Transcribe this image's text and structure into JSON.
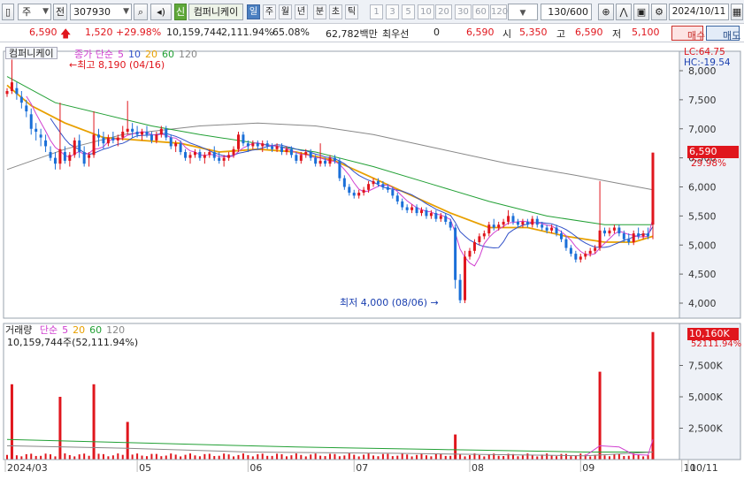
{
  "toolbar": {
    "market": "주",
    "prefix": "전",
    "code": "307930",
    "new_tag": "신",
    "stock_name": "컴퍼니케이",
    "periods": [
      "일",
      "주",
      "월",
      "년",
      "분",
      "초",
      "틱"
    ],
    "active_period": "일",
    "intervals": [
      "1",
      "3",
      "5",
      "10",
      "20",
      "30",
      "60",
      "120"
    ],
    "count": "130",
    "total": "/600",
    "date": "2024/10/11"
  },
  "quote": {
    "price": "6,590",
    "change": "1,520",
    "change_pct": "+29.98%",
    "volume": "10,159,744",
    "volume_ratio": "2,111.94%",
    "turnover": "65.08%",
    "amount": "62,782백만",
    "priority_label": "최우선",
    "priority_value": "0",
    "current": "6,590",
    "open_label": "시",
    "open": "5,350",
    "high_label": "고",
    "high": "6,590",
    "low_label": "저",
    "low": "5,100",
    "buy_label": "매수",
    "sell_label": "매도"
  },
  "price_panel": {
    "stock_tag": "컴퍼니케이",
    "legend": [
      {
        "text": "종가 단순",
        "color": "#d040d0"
      },
      {
        "text": "5",
        "color": "#d040d0"
      },
      {
        "text": "10",
        "color": "#3050c8"
      },
      {
        "text": "20",
        "color": "#e8a000"
      },
      {
        "text": "60",
        "color": "#22a035"
      },
      {
        "text": "120",
        "color": "#888888"
      }
    ],
    "high_annotation": "최고 8,190 (04/16)",
    "low_annotation": "최저 4,000 (08/06)",
    "lc": "LC:64.75",
    "hc": "HC:-19.54",
    "current_badge": "6,590",
    "current_pct": "29.98%",
    "y_ticks": [
      "8,000",
      "7,500",
      "7,000",
      "6,500",
      "6,000",
      "5,500",
      "5,000",
      "4,500",
      "4,000"
    ],
    "y_tick_values": [
      8000,
      7500,
      7000,
      6500,
      6000,
      5500,
      5000,
      4500,
      4000
    ]
  },
  "volume_panel": {
    "title": "거래량",
    "legend": [
      {
        "text": "단순",
        "color": "#d040d0"
      },
      {
        "text": "5",
        "color": "#d040d0"
      },
      {
        "text": "20",
        "color": "#e8a000"
      },
      {
        "text": "60",
        "color": "#22a035"
      },
      {
        "text": "120",
        "color": "#888888"
      }
    ],
    "summary": "10,159,744주(52,111.94%)",
    "current_badge": "10,160K",
    "current_pct": "52111.94%",
    "y_ticks": [
      "7,500K",
      "5,000K",
      "2,500K"
    ],
    "y_tick_values": [
      7500,
      5000,
      2500
    ]
  },
  "x_axis": {
    "labels": [
      {
        "text": "2024/03",
        "day": 0
      },
      {
        "text": "05",
        "day": 27
      },
      {
        "text": "06",
        "day": 50
      },
      {
        "text": "07",
        "day": 72
      },
      {
        "text": "08",
        "day": 96
      },
      {
        "text": "09",
        "day": 119
      },
      {
        "text": "10",
        "day": 140
      },
      {
        "text": "10/11",
        "day": 157
      }
    ]
  },
  "colors": {
    "up": "#e0161d",
    "down": "#1a6fd8",
    "ma5": "#d040d0",
    "ma10": "#3050c8",
    "ma20": "#e8a000",
    "ma60": "#22a035",
    "ma120": "#888888"
  },
  "chart_data": {
    "type": "candlestick",
    "x_unit": "trading day",
    "ylim": [
      3800,
      8200
    ],
    "candles": [
      [
        0,
        7600,
        7700,
        7550,
        7650
      ],
      [
        1,
        7650,
        8190,
        7600,
        7800
      ],
      [
        2,
        7700,
        7800,
        7500,
        7600
      ],
      [
        3,
        7550,
        7650,
        7350,
        7450
      ],
      [
        4,
        7400,
        7500,
        7200,
        7300
      ],
      [
        5,
        7250,
        7350,
        6900,
        7000
      ],
      [
        6,
        7000,
        7100,
        6800,
        6950
      ],
      [
        7,
        6900,
        7000,
        6700,
        6850
      ],
      [
        8,
        6800,
        6900,
        6600,
        6700
      ],
      [
        9,
        6600,
        6700,
        6450,
        6500
      ],
      [
        10,
        6500,
        6600,
        6300,
        6400
      ],
      [
        11,
        6400,
        7450,
        6300,
        6650
      ],
      [
        12,
        6600,
        6700,
        6400,
        6450
      ],
      [
        13,
        6450,
        6600,
        6350,
        6550
      ],
      [
        14,
        6550,
        6850,
        6500,
        6800
      ],
      [
        15,
        6800,
        6900,
        6500,
        6600
      ],
      [
        16,
        6600,
        6700,
        6350,
        6400
      ],
      [
        17,
        6500,
        6600,
        6350,
        6550
      ],
      [
        18,
        6550,
        7300,
        6500,
        6900
      ],
      [
        19,
        6900,
        7000,
        6700,
        6850
      ],
      [
        20,
        6850,
        6950,
        6650,
        6750
      ],
      [
        21,
        6750,
        6900,
        6700,
        6850
      ],
      [
        22,
        6850,
        6950,
        6750,
        6800
      ],
      [
        23,
        6800,
        6900,
        6700,
        6850
      ],
      [
        24,
        6850,
        7050,
        6800,
        6950
      ],
      [
        25,
        6950,
        7480,
        6900,
        7000
      ],
      [
        26,
        7000,
        7100,
        6850,
        6950
      ],
      [
        27,
        6950,
        7050,
        6850,
        6900
      ],
      [
        28,
        6900,
        7000,
        6800,
        6950
      ],
      [
        29,
        6950,
        7050,
        6850,
        6900
      ],
      [
        30,
        6900,
        6950,
        6750,
        6800
      ],
      [
        31,
        6800,
        6950,
        6750,
        6900
      ],
      [
        32,
        6900,
        7050,
        6850,
        7000
      ],
      [
        33,
        7000,
        7050,
        6800,
        6850
      ],
      [
        34,
        6850,
        6900,
        6650,
        6700
      ],
      [
        35,
        6700,
        6800,
        6600,
        6750
      ],
      [
        36,
        6750,
        6800,
        6550,
        6600
      ],
      [
        37,
        6600,
        6650,
        6450,
        6500
      ],
      [
        38,
        6500,
        6600,
        6400,
        6550
      ],
      [
        39,
        6550,
        6650,
        6500,
        6600
      ],
      [
        40,
        6600,
        6650,
        6450,
        6500
      ],
      [
        41,
        6500,
        6600,
        6400,
        6550
      ],
      [
        42,
        6550,
        6650,
        6500,
        6600
      ],
      [
        43,
        6600,
        6700,
        6450,
        6500
      ],
      [
        44,
        6500,
        6600,
        6400,
        6450
      ],
      [
        45,
        6450,
        6550,
        6350,
        6500
      ],
      [
        46,
        6500,
        6600,
        6450,
        6550
      ],
      [
        47,
        6550,
        6700,
        6500,
        6650
      ],
      [
        48,
        6650,
        6950,
        6600,
        6900
      ],
      [
        49,
        6900,
        6950,
        6700,
        6750
      ],
      [
        50,
        6750,
        6800,
        6600,
        6700
      ],
      [
        51,
        6700,
        6800,
        6650,
        6750
      ],
      [
        52,
        6750,
        6800,
        6650,
        6700
      ],
      [
        53,
        6700,
        6800,
        6600,
        6750
      ],
      [
        54,
        6750,
        6800,
        6650,
        6700
      ],
      [
        55,
        6700,
        6750,
        6600,
        6650
      ],
      [
        56,
        6650,
        6750,
        6600,
        6700
      ],
      [
        57,
        6700,
        6750,
        6550,
        6600
      ],
      [
        58,
        6600,
        6700,
        6550,
        6650
      ],
      [
        59,
        6650,
        6700,
        6500,
        6550
      ],
      [
        60,
        6550,
        6600,
        6400,
        6450
      ],
      [
        61,
        6450,
        6600,
        6400,
        6550
      ],
      [
        62,
        6550,
        6650,
        6500,
        6600
      ],
      [
        63,
        6600,
        6650,
        6450,
        6500
      ],
      [
        64,
        6500,
        6550,
        6350,
        6400
      ],
      [
        65,
        6400,
        6750,
        6350,
        6450
      ],
      [
        66,
        6450,
        6500,
        6350,
        6400
      ],
      [
        67,
        6400,
        6550,
        6350,
        6500
      ],
      [
        68,
        6500,
        6550,
        6400,
        6450
      ],
      [
        69,
        6450,
        6500,
        6100,
        6150
      ],
      [
        70,
        6150,
        6200,
        5950,
        6000
      ],
      [
        71,
        6000,
        6050,
        5850,
        5900
      ],
      [
        72,
        5900,
        5950,
        5800,
        5850
      ],
      [
        73,
        5850,
        5950,
        5800,
        5900
      ],
      [
        74,
        5900,
        6000,
        5850,
        5950
      ],
      [
        75,
        5950,
        6100,
        5900,
        6050
      ],
      [
        76,
        6050,
        6150,
        6000,
        6100
      ],
      [
        77,
        6100,
        6150,
        6000,
        6050
      ],
      [
        78,
        6050,
        6100,
        5950,
        6000
      ],
      [
        79,
        6000,
        6050,
        5900,
        5950
      ],
      [
        80,
        5950,
        6000,
        5800,
        5850
      ],
      [
        81,
        5850,
        5900,
        5700,
        5750
      ],
      [
        82,
        5750,
        5800,
        5600,
        5650
      ],
      [
        83,
        5650,
        5700,
        5550,
        5600
      ],
      [
        84,
        5600,
        5700,
        5550,
        5650
      ],
      [
        85,
        5650,
        5700,
        5500,
        5550
      ],
      [
        86,
        5550,
        5650,
        5500,
        5600
      ],
      [
        87,
        5600,
        5650,
        5450,
        5500
      ],
      [
        88,
        5500,
        5600,
        5450,
        5550
      ],
      [
        89,
        5550,
        5600,
        5400,
        5450
      ],
      [
        90,
        5450,
        5550,
        5400,
        5500
      ],
      [
        91,
        5500,
        5550,
        5350,
        5400
      ],
      [
        92,
        5400,
        5450,
        5250,
        5300
      ],
      [
        93,
        5300,
        5350,
        4250,
        4400
      ],
      [
        94,
        4400,
        4500,
        4000,
        4050
      ],
      [
        95,
        4050,
        4900,
        4000,
        4800
      ],
      [
        96,
        4800,
        4950,
        4750,
        4900
      ],
      [
        97,
        4900,
        5100,
        4850,
        5050
      ],
      [
        98,
        5050,
        5200,
        5000,
        5150
      ],
      [
        99,
        5150,
        5250,
        5100,
        5200
      ],
      [
        100,
        5200,
        5400,
        5150,
        5350
      ],
      [
        101,
        5350,
        5450,
        5250,
        5300
      ],
      [
        102,
        5300,
        5400,
        5250,
        5350
      ],
      [
        103,
        5350,
        5450,
        5300,
        5400
      ],
      [
        104,
        5400,
        5600,
        5350,
        5500
      ],
      [
        105,
        5500,
        5550,
        5350,
        5400
      ],
      [
        106,
        5400,
        5450,
        5300,
        5350
      ],
      [
        107,
        5350,
        5450,
        5300,
        5400
      ],
      [
        108,
        5400,
        5450,
        5300,
        5350
      ],
      [
        109,
        5350,
        5500,
        5300,
        5450
      ],
      [
        110,
        5450,
        5500,
        5300,
        5350
      ],
      [
        111,
        5350,
        5400,
        5250,
        5300
      ],
      [
        112,
        5300,
        5350,
        5200,
        5250
      ],
      [
        113,
        5250,
        5350,
        5200,
        5300
      ],
      [
        114,
        5300,
        5350,
        5150,
        5200
      ],
      [
        115,
        5200,
        5250,
        5050,
        5100
      ],
      [
        116,
        5100,
        5150,
        4900,
        4950
      ],
      [
        117,
        4950,
        5000,
        4800,
        4850
      ],
      [
        118,
        4850,
        4900,
        4700,
        4750
      ],
      [
        119,
        4750,
        4850,
        4700,
        4800
      ],
      [
        120,
        4800,
        4900,
        4750,
        4850
      ],
      [
        121,
        4850,
        4950,
        4800,
        4900
      ],
      [
        122,
        4900,
        5000,
        4850,
        4950
      ],
      [
        123,
        4950,
        6100,
        4900,
        5250
      ],
      [
        124,
        5250,
        5300,
        5150,
        5200
      ],
      [
        125,
        5200,
        5300,
        5150,
        5250
      ],
      [
        126,
        5250,
        5350,
        5200,
        5300
      ],
      [
        127,
        5300,
        5350,
        5150,
        5200
      ],
      [
        128,
        5200,
        5250,
        5050,
        5100
      ],
      [
        129,
        5100,
        5200,
        5000,
        5050
      ],
      [
        130,
        5050,
        5250,
        5000,
        5200
      ],
      [
        131,
        5200,
        5300,
        5100,
        5150
      ],
      [
        132,
        5150,
        5250,
        5100,
        5200
      ],
      [
        133,
        5200,
        5300,
        5100,
        5150
      ],
      [
        134,
        5350,
        6590,
        5100,
        6590
      ]
    ],
    "ma_lines": {
      "ma20": [
        [
          0,
          7750
        ],
        [
          5,
          7400
        ],
        [
          12,
          7100
        ],
        [
          20,
          6850
        ],
        [
          28,
          6800
        ],
        [
          36,
          6750
        ],
        [
          44,
          6600
        ],
        [
          52,
          6650
        ],
        [
          60,
          6600
        ],
        [
          68,
          6450
        ],
        [
          76,
          6150
        ],
        [
          84,
          5850
        ],
        [
          92,
          5550
        ],
        [
          100,
          5300
        ],
        [
          108,
          5300
        ],
        [
          116,
          5150
        ],
        [
          124,
          5050
        ],
        [
          130,
          5050
        ],
        [
          134,
          5150
        ]
      ],
      "ma60": [
        [
          0,
          7900
        ],
        [
          10,
          7450
        ],
        [
          20,
          7250
        ],
        [
          30,
          7050
        ],
        [
          40,
          6900
        ],
        [
          52,
          6750
        ],
        [
          64,
          6600
        ],
        [
          76,
          6350
        ],
        [
          88,
          6050
        ],
        [
          100,
          5750
        ],
        [
          112,
          5500
        ],
        [
          124,
          5350
        ],
        [
          134,
          5350
        ]
      ],
      "ma120": [
        [
          0,
          6300
        ],
        [
          12,
          6650
        ],
        [
          24,
          6900
        ],
        [
          40,
          7050
        ],
        [
          52,
          7100
        ],
        [
          64,
          7050
        ],
        [
          76,
          6900
        ],
        [
          90,
          6650
        ],
        [
          104,
          6400
        ],
        [
          118,
          6200
        ],
        [
          134,
          5950
        ]
      ]
    },
    "volumes": [
      [
        1,
        6
      ],
      [
        11,
        5
      ],
      [
        18,
        6
      ],
      [
        25,
        3
      ],
      [
        93,
        2
      ],
      [
        123,
        7
      ],
      [
        134,
        10.16
      ]
    ]
  }
}
